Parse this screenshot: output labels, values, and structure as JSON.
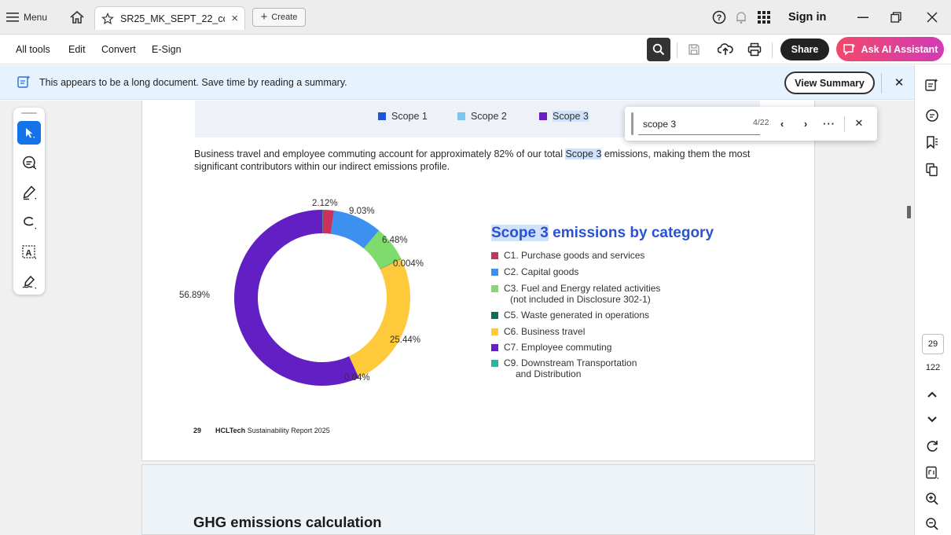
{
  "titlebar": {
    "menu_label": "Menu",
    "tab_title": "SR25_MK_SEPT_22_co...",
    "create_label": "Create",
    "sign_in": "Sign in"
  },
  "toolbar": {
    "menu_items": [
      "All tools",
      "Edit",
      "Convert",
      "E-Sign"
    ],
    "share_label": "Share",
    "ai_label": "Ask AI Assistant"
  },
  "banner": {
    "message": "This appears to be a long document. Save time by reading a summary.",
    "view_summary": "View Summary"
  },
  "find": {
    "query": "scope 3",
    "count": "4/22"
  },
  "document": {
    "top_legend": [
      {
        "label": "Scope 1",
        "color": "#1f56d6"
      },
      {
        "label": "Scope 2",
        "color": "#7cc6ee"
      },
      {
        "label": "Scope 3",
        "color": "#6a1fc2"
      }
    ],
    "paragraph_before": "Business travel and employee commuting account for approximately 82% of our total ",
    "paragraph_highlight": "Scope 3",
    "paragraph_after": " emissions, making them the most significant contributors within our indirect emissions profile.",
    "chart_title_highlight": "Scope 3",
    "chart_title_rest": " emissions by category",
    "footer_page": "29",
    "footer_brand": "HCLTech",
    "footer_report": " Sustainability Report 2025",
    "next_heading": "GHG emissions calculation"
  },
  "chart_data": {
    "type": "pie",
    "subtype": "donut",
    "title": "Scope 3 emissions by category",
    "series": [
      {
        "name": "C1. Purchase goods and services",
        "value": 2.12,
        "label": "2.12%",
        "color": "#c9325a"
      },
      {
        "name": "C2. Capital goods",
        "value": 9.03,
        "label": "9.03%",
        "color": "#3d8ff0"
      },
      {
        "name": "C3. Fuel and Energy related activities (not included in Disclosure 302-1)",
        "value": 6.48,
        "label": "6.48%",
        "color": "#7fdc6c"
      },
      {
        "name": "C5. Waste generated in operations",
        "value": 0.004,
        "label": "0.004%",
        "color": "#0e6b5e"
      },
      {
        "name": "C6. Business travel",
        "value": 25.44,
        "label": "25.44%",
        "color": "#ffc93c"
      },
      {
        "name": "C7. Employee commuting",
        "value": 56.89,
        "label": "56.89%",
        "color": "#6220c4"
      },
      {
        "name": "C9. Downstream Transportation and Distribution",
        "value": 0.04,
        "label": "0.04%",
        "color": "#2fb3a0"
      }
    ],
    "legend_lines": [
      [
        "C1. Purchase goods and services"
      ],
      [
        "C2. Capital goods"
      ],
      [
        "C3. Fuel and Energy related activities",
        "(not included in Disclosure 302-1)"
      ],
      [
        "C5. Waste generated in operations"
      ],
      [
        "C6. Business travel"
      ],
      [
        "C7. Employee commuting"
      ],
      [
        "C9. Downstream Transportation",
        "and Distribution"
      ]
    ],
    "legend_position": "right"
  },
  "right_rail": {
    "current_page": "29",
    "total_pages": "122"
  }
}
